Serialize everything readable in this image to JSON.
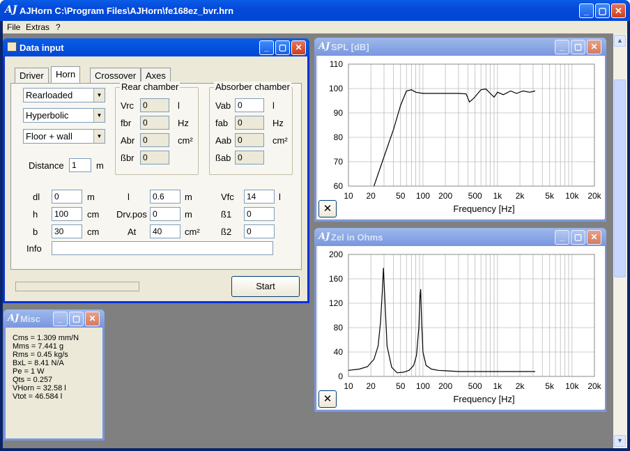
{
  "app": {
    "title": "AJHorn  C:\\Program Files\\AJHorn\\fe168ez_bvr.hrn",
    "logo": "AJ"
  },
  "menu": [
    "File",
    "Extras",
    "?"
  ],
  "data_input": {
    "title": "Data input",
    "tabs": [
      "Driver",
      "Horn",
      "Crossover",
      "Axes"
    ],
    "selected_tab": "Horn",
    "loading": "Rearloaded",
    "flare": "Hyperbolic",
    "placement": "Floor + wall",
    "distance_label": "Distance",
    "distance_value": "1",
    "distance_unit": "m",
    "rear": {
      "title": "Rear chamber",
      "rows": [
        {
          "label": "Vrc",
          "value": "0",
          "unit": "l"
        },
        {
          "label": "fbr",
          "value": "0",
          "unit": "Hz"
        },
        {
          "label": "Abr",
          "value": "0",
          "unit": "cm²"
        },
        {
          "label": "ßbr",
          "value": "0",
          "unit": ""
        }
      ]
    },
    "absorber": {
      "title": "Absorber chamber",
      "rows": [
        {
          "label": "Vab",
          "value": "0",
          "unit": "l"
        },
        {
          "label": "fab",
          "value": "0",
          "unit": "Hz"
        },
        {
          "label": "Aab",
          "value": "0",
          "unit": "cm²"
        },
        {
          "label": "ßab",
          "value": "0",
          "unit": ""
        }
      ]
    },
    "col1": [
      {
        "label": "dl",
        "value": "0",
        "unit": "m"
      },
      {
        "label": "h",
        "value": "100",
        "unit": "cm"
      },
      {
        "label": "b",
        "value": "30",
        "unit": "cm"
      }
    ],
    "col2": [
      {
        "label": "l",
        "value": "0.6",
        "unit": "m"
      },
      {
        "label": "Drv.pos",
        "value": "0",
        "unit": "m"
      },
      {
        "label": "At",
        "value": "40",
        "unit": "cm²"
      }
    ],
    "col3": [
      {
        "label": "Vfc",
        "value": "14",
        "unit": "l"
      },
      {
        "label": "ß1",
        "value": "0",
        "unit": ""
      },
      {
        "label": "ß2",
        "value": "0",
        "unit": ""
      }
    ],
    "info_label": "Info",
    "info_value": "",
    "start_label": "Start"
  },
  "misc": {
    "title": "Misc",
    "lines": [
      "Cms = 1.309 mm/N",
      "Mms = 7.441 g",
      "Rms = 0.45 kg/s",
      "BxL = 8.41 N/A",
      "Pe = 1 W",
      "Qts = 0.257",
      "VHorn = 32.58 l",
      "Vtot = 46.584 l"
    ]
  },
  "chart_data": [
    {
      "type": "line",
      "window_title": "SPL [dB]",
      "xlabel": "Frequency [Hz]",
      "x_scale": "log",
      "xlim": [
        10,
        20000
      ],
      "ylim": [
        60,
        110
      ],
      "x_ticks": [
        "10",
        "20",
        "50",
        "100",
        "200",
        "500",
        "1k",
        "2k",
        "5k",
        "10k",
        "20k"
      ],
      "y_ticks": [
        "110",
        "100",
        "90",
        "80",
        "70",
        "60"
      ],
      "grid": true,
      "x": [
        22,
        30,
        40,
        50,
        60,
        70,
        80,
        100,
        150,
        200,
        300,
        380,
        420,
        480,
        600,
        700,
        800,
        900,
        1000,
        1200,
        1500,
        1800,
        2200,
        2700,
        3200
      ],
      "y": [
        60,
        72,
        83,
        93,
        99,
        99.5,
        98.5,
        98,
        98,
        98,
        98,
        97.8,
        94.5,
        96,
        99.5,
        99.8,
        98,
        96.5,
        98.5,
        97.5,
        99,
        98,
        99,
        98.5,
        99
      ]
    },
    {
      "type": "line",
      "window_title": "Zel in Ohms",
      "xlabel": "Frequency [Hz]",
      "x_scale": "log",
      "xlim": [
        10,
        20000
      ],
      "ylim": [
        0,
        200
      ],
      "x_ticks": [
        "10",
        "20",
        "50",
        "100",
        "200",
        "500",
        "1k",
        "2k",
        "5k",
        "10k",
        "20k"
      ],
      "y_ticks": [
        "200",
        "160",
        "120",
        "80",
        "40",
        "0"
      ],
      "grid": true,
      "x": [
        10,
        14,
        18,
        22,
        25,
        27,
        28.5,
        29.5,
        31,
        33,
        38,
        45,
        55,
        65,
        75,
        82,
        88,
        91,
        93,
        96,
        100,
        110,
        130,
        160,
        220,
        300,
        500,
        1000,
        2000,
        3200
      ],
      "y": [
        10,
        12,
        16,
        28,
        50,
        90,
        140,
        178,
        120,
        50,
        15,
        6,
        7,
        10,
        18,
        35,
        80,
        130,
        143,
        90,
        40,
        18,
        12,
        10,
        9,
        8,
        8,
        8,
        8,
        8
      ]
    }
  ]
}
